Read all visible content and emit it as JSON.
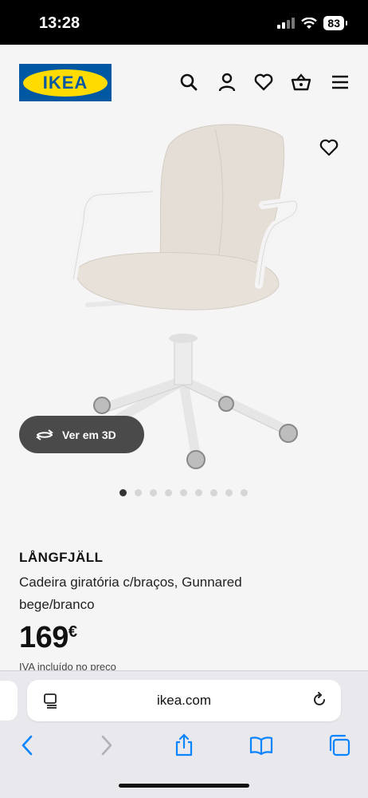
{
  "status_bar": {
    "time": "13:28",
    "battery": "83"
  },
  "header": {
    "logo_text": "IKEA",
    "icons": [
      "search-icon",
      "user-icon",
      "heart-icon",
      "shopping-basket-icon",
      "menu-icon"
    ]
  },
  "gallery": {
    "view3d_label": "Ver em 3D",
    "image_count": 9,
    "active_index": 0
  },
  "product": {
    "name": "LÅNGFJÄLL",
    "description": "Cadeira giratória c/braços, Gunnared bege/branco",
    "price": "169",
    "currency": "€",
    "vat_note": "IVA incluído no preço"
  },
  "browser": {
    "url": "ikea.com"
  },
  "colors": {
    "ikea_blue": "#0058a3",
    "ikea_yellow": "#ffdb00",
    "safari_blue": "#0a84ff"
  }
}
